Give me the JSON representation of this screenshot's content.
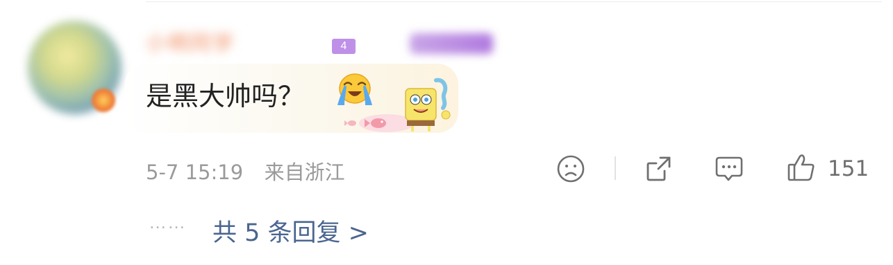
{
  "comment": {
    "username_label": "小明同学",
    "vip_tag": "4",
    "text": "是黑大帅吗？",
    "emoji_icon": "crying-face-icon",
    "decoration": "spongebob-bubble-decoration",
    "timestamp": "5-7 15:19",
    "location": "来自浙江",
    "like_count": "151"
  },
  "actions": {
    "icons": [
      "sad-face-icon",
      "share-icon",
      "comment-icon",
      "thumbs-up-icon"
    ]
  },
  "replies": {
    "dots": "……",
    "label": "共 5 条回复 >"
  },
  "colors": {
    "link": "#4a6590",
    "meta": "#9a9a9a",
    "text": "#222222",
    "icon": "#6f6f6f"
  }
}
